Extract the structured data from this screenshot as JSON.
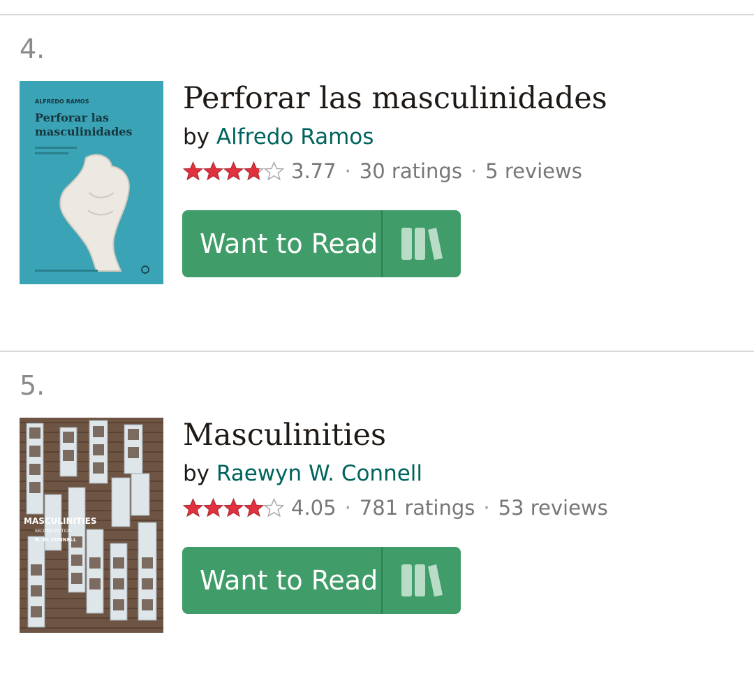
{
  "books": [
    {
      "rank": "4.",
      "title": "Perforar las masculinidades",
      "by": "by",
      "author": "Alfredo Ramos",
      "rating": "3.77",
      "rating_value": 3.77,
      "ratings_count": "30 ratings",
      "reviews_count": "5 reviews",
      "button_label": "Want to Read",
      "cover": {
        "author": "ALFREDO RAMOS",
        "title_line1": "Perforar las",
        "title_line2": "masculinidades",
        "bg_color": "#3aa3b5"
      }
    },
    {
      "rank": "5.",
      "title": "Masculinities",
      "by": "by",
      "author": "Raewyn W. Connell",
      "rating": "4.05",
      "rating_value": 4.05,
      "ratings_count": "781 ratings",
      "reviews_count": "53 reviews",
      "button_label": "Want to Read",
      "cover": {
        "title": "MASCULINITIES",
        "subtitle": "SECOND EDITION",
        "author": "R. W. CONNELL",
        "bg_color": "#6b5040"
      }
    }
  ],
  "colors": {
    "accent_green": "#409d69",
    "author_link": "#00635d",
    "star_red": "#e0313f",
    "divider": "#d8d8d8"
  }
}
